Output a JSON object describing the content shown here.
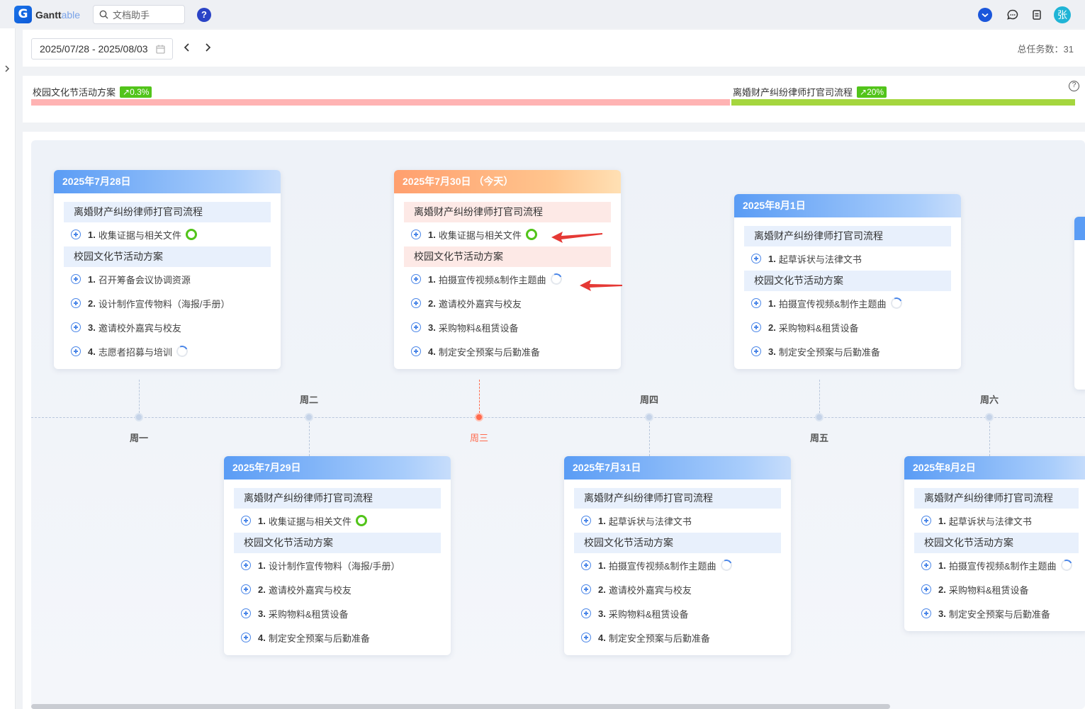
{
  "app": {
    "logo_prefix": "Gantt",
    "logo_suffix": "able",
    "search_placeholder": "文档助手",
    "help_label": "?",
    "avatar_label": "张"
  },
  "toolbar": {
    "date_range": "2025/07/28 - 2025/08/03",
    "total_tasks": "总任务数：31"
  },
  "projects": [
    {
      "name": "校园文化节活动方案",
      "progress": "↗0.3%",
      "bar_color": "#ffb3b3"
    },
    {
      "name": "离婚财产纠纷律师打官司流程",
      "progress": "↗20%",
      "bar_color": "#a5d63e"
    }
  ],
  "weekdays": [
    "周一",
    "周二",
    "周三",
    "周四",
    "周五",
    "周六"
  ],
  "days": [
    {
      "title": "2025年7月28日",
      "groups": [
        {
          "name": "离婚财产纠纷律师打官司流程",
          "tasks": [
            {
              "num": "1.",
              "text": "收集证据与相关文件",
              "status": "done"
            }
          ]
        },
        {
          "name": "校园文化节活动方案",
          "tasks": [
            {
              "num": "1.",
              "text": "召开筹备会议协调资源",
              "status": "none"
            },
            {
              "num": "2.",
              "text": "设计制作宣传物料（海报/手册）",
              "status": "none"
            },
            {
              "num": "3.",
              "text": "邀请校外嘉宾与校友",
              "status": "none"
            },
            {
              "num": "4.",
              "text": "志愿者招募与培训",
              "status": "progress"
            }
          ]
        }
      ]
    },
    {
      "title": "2025年7月29日",
      "groups": [
        {
          "name": "离婚财产纠纷律师打官司流程",
          "tasks": [
            {
              "num": "1.",
              "text": "收集证据与相关文件",
              "status": "done"
            }
          ]
        },
        {
          "name": "校园文化节活动方案",
          "tasks": [
            {
              "num": "1.",
              "text": "设计制作宣传物料（海报/手册）",
              "status": "none"
            },
            {
              "num": "2.",
              "text": "邀请校外嘉宾与校友",
              "status": "none"
            },
            {
              "num": "3.",
              "text": "采购物料&租赁设备",
              "status": "none"
            },
            {
              "num": "4.",
              "text": "制定安全预案与后勤准备",
              "status": "none"
            }
          ]
        }
      ]
    },
    {
      "title": "2025年7月30日 （今天）",
      "today": true,
      "groups": [
        {
          "name": "离婚财产纠纷律师打官司流程",
          "tasks": [
            {
              "num": "1.",
              "text": "收集证据与相关文件",
              "status": "done"
            }
          ]
        },
        {
          "name": "校园文化节活动方案",
          "tasks": [
            {
              "num": "1.",
              "text": "拍摄宣传视频&制作主题曲",
              "status": "progress"
            },
            {
              "num": "2.",
              "text": "邀请校外嘉宾与校友",
              "status": "none"
            },
            {
              "num": "3.",
              "text": "采购物料&租赁设备",
              "status": "none"
            },
            {
              "num": "4.",
              "text": "制定安全预案与后勤准备",
              "status": "none"
            }
          ]
        }
      ]
    },
    {
      "title": "2025年7月31日",
      "groups": [
        {
          "name": "离婚财产纠纷律师打官司流程",
          "tasks": [
            {
              "num": "1.",
              "text": "起草诉状与法律文书",
              "status": "none"
            }
          ]
        },
        {
          "name": "校园文化节活动方案",
          "tasks": [
            {
              "num": "1.",
              "text": "拍摄宣传视频&制作主题曲",
              "status": "progress"
            },
            {
              "num": "2.",
              "text": "邀请校外嘉宾与校友",
              "status": "none"
            },
            {
              "num": "3.",
              "text": "采购物料&租赁设备",
              "status": "none"
            },
            {
              "num": "4.",
              "text": "制定安全预案与后勤准备",
              "status": "none"
            }
          ]
        }
      ]
    },
    {
      "title": "2025年8月1日",
      "groups": [
        {
          "name": "离婚财产纠纷律师打官司流程",
          "tasks": [
            {
              "num": "1.",
              "text": "起草诉状与法律文书",
              "status": "none"
            }
          ]
        },
        {
          "name": "校园文化节活动方案",
          "tasks": [
            {
              "num": "1.",
              "text": "拍摄宣传视频&制作主题曲",
              "status": "progress"
            },
            {
              "num": "2.",
              "text": "采购物料&租赁设备",
              "status": "none"
            },
            {
              "num": "3.",
              "text": "制定安全预案与后勤准备",
              "status": "none"
            }
          ]
        }
      ]
    },
    {
      "title": "2025年8月2日",
      "groups": [
        {
          "name": "离婚财产纠纷律师打官司流程",
          "tasks": [
            {
              "num": "1.",
              "text": "起草诉状与法律文书",
              "status": "none"
            }
          ]
        },
        {
          "name": "校园文化节活动方案",
          "tasks": [
            {
              "num": "1.",
              "text": "拍摄宣传视频&制作主题曲",
              "status": "progress"
            },
            {
              "num": "2.",
              "text": "采购物料&租赁设备",
              "status": "none"
            },
            {
              "num": "3.",
              "text": "制定安全预案与后勤准备",
              "status": "none"
            }
          ]
        }
      ]
    }
  ]
}
